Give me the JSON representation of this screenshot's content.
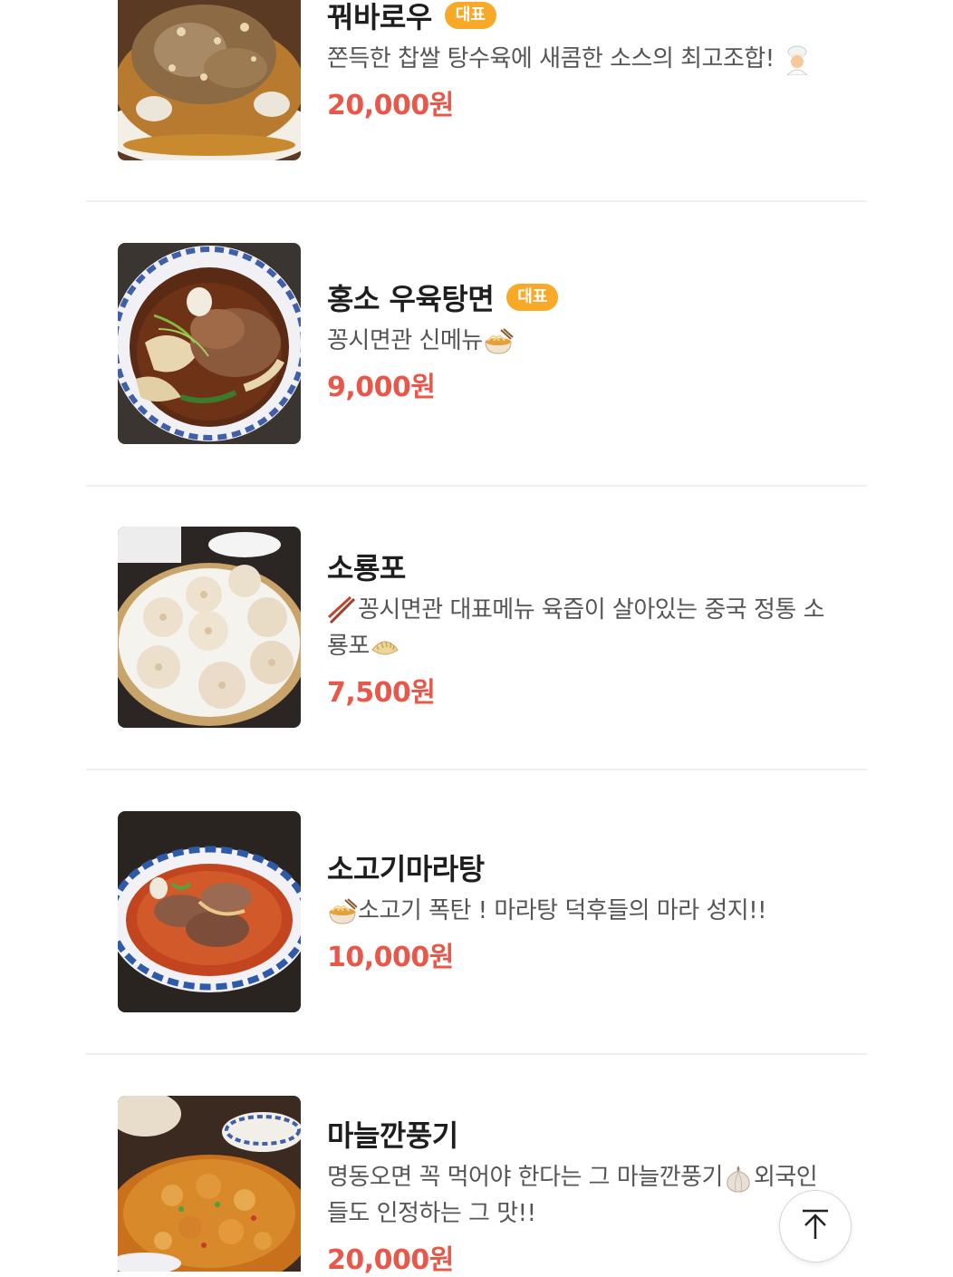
{
  "menu_items": [
    {
      "name": "꿔바로우",
      "badge": "대표",
      "description": "쫀득한 찹쌀 탕수육에 새콤한 소스의 최고조합!",
      "price": "20,000원",
      "emoji": "chef"
    },
    {
      "name": "홍소 우육탕면",
      "badge": "대표",
      "description": "꽁시면관 신메뉴",
      "price": "9,000원",
      "emoji": "noodle-bowl"
    },
    {
      "name": "소룡포",
      "badge": "",
      "description_line1": "꽁시면관 대표메뉴 육즙이 살아있는 중국 정통 소",
      "description_line2": "룡포",
      "price": "7,500원",
      "emoji_lead": "chopsticks",
      "emoji_tail": "dumpling"
    },
    {
      "name": "소고기마라탕",
      "badge": "",
      "description": "소고기 폭탄 ! 마라탕 덕후들의 마라 성지!!",
      "price": "10,000원",
      "emoji": "noodle-bowl"
    },
    {
      "name": "마늘깐풍기",
      "badge": "",
      "description_line1_a": "명동오면 꼭 먹어야 한다는 그 마늘깐풍기",
      "description_line1_b": "외국인",
      "description_line2": "들도 인정하는 그 맛!!",
      "price": "20,000원",
      "emoji": "garlic"
    }
  ],
  "scroll_top": {
    "icon": "arrow-up-to-top-icon"
  },
  "colors": {
    "price": "#e8584a",
    "badge": "#f8a928",
    "divider": "#efefef"
  }
}
